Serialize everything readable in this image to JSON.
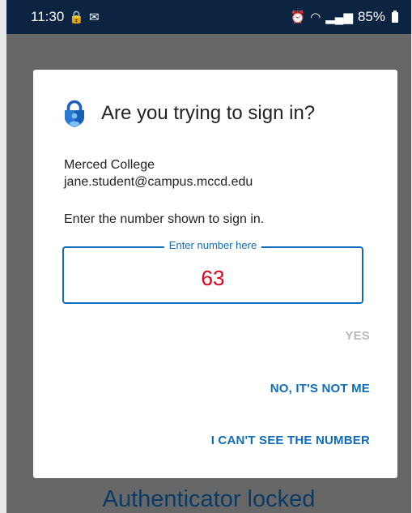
{
  "status_bar": {
    "time": "11:30",
    "battery": "85%",
    "icons": [
      "authenticator-lock-icon",
      "outlook-icon",
      "alarm-icon",
      "wifi-icon",
      "signal-icon",
      "battery-icon"
    ]
  },
  "dialog": {
    "title": "Are you trying to sign in?",
    "organization": "Merced College",
    "account": "jane.student@campus.mccd.edu",
    "instruction": "Enter the number shown to sign in.",
    "number_field": {
      "label": "Enter number here",
      "value": "63"
    },
    "buttons": {
      "yes": "YES",
      "not_me": "NO, IT'S NOT ME",
      "cant_see": "I CAN'T SEE THE NUMBER"
    }
  },
  "background": {
    "title": "Authenticator locked"
  },
  "colors": {
    "status_bar": "#0c2442",
    "accent": "#0f6cbd",
    "number": "#e0001b",
    "disabled": "#b8b8b8",
    "scrim": "#676767"
  }
}
